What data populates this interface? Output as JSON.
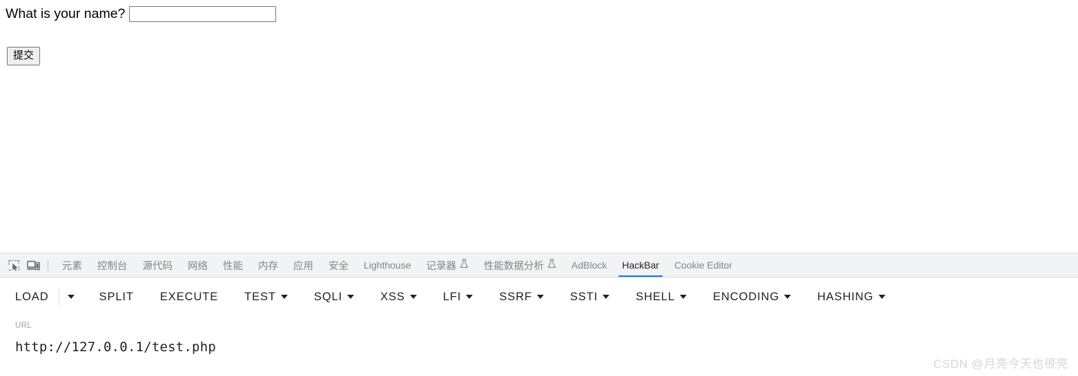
{
  "page": {
    "question_label": "What is your name?",
    "name_input_value": "",
    "name_input_placeholder": "",
    "submit_label": "提交"
  },
  "devtools": {
    "icons": [
      {
        "name": "inspect-element-icon",
        "label": "检查元素"
      },
      {
        "name": "device-toolbar-icon",
        "label": "切换设备工具栏"
      }
    ],
    "tabs": [
      {
        "label": "元素",
        "active": false,
        "experimental": false,
        "lang": "cn"
      },
      {
        "label": "控制台",
        "active": false,
        "experimental": false,
        "lang": "cn"
      },
      {
        "label": "源代码",
        "active": false,
        "experimental": false,
        "lang": "cn"
      },
      {
        "label": "网络",
        "active": false,
        "experimental": false,
        "lang": "cn"
      },
      {
        "label": "性能",
        "active": false,
        "experimental": false,
        "lang": "cn"
      },
      {
        "label": "内存",
        "active": false,
        "experimental": false,
        "lang": "cn"
      },
      {
        "label": "应用",
        "active": false,
        "experimental": false,
        "lang": "cn"
      },
      {
        "label": "安全",
        "active": false,
        "experimental": false,
        "lang": "cn"
      },
      {
        "label": "Lighthouse",
        "active": false,
        "experimental": false,
        "lang": "en"
      },
      {
        "label": "记录器",
        "active": false,
        "experimental": true,
        "lang": "cn"
      },
      {
        "label": "性能数据分析",
        "active": false,
        "experimental": true,
        "lang": "cn"
      },
      {
        "label": "AdBlock",
        "active": false,
        "experimental": false,
        "lang": "en"
      },
      {
        "label": "HackBar",
        "active": true,
        "experimental": false,
        "lang": "en"
      },
      {
        "label": "Cookie Editor",
        "active": false,
        "experimental": false,
        "lang": "en"
      }
    ],
    "active_tab": "HackBar",
    "accent_color": "#1a73e8",
    "tabbar_background": "#f1f3f4"
  },
  "hackbar": {
    "buttons": [
      {
        "label": "LOAD",
        "caret": false
      },
      {
        "label": "SPLIT",
        "caret": false
      },
      {
        "label": "EXECUTE",
        "caret": false
      },
      {
        "label": "TEST",
        "caret": true
      },
      {
        "label": "SQLI",
        "caret": true
      },
      {
        "label": "XSS",
        "caret": true
      },
      {
        "label": "LFI",
        "caret": true
      },
      {
        "label": "SSRF",
        "caret": true
      },
      {
        "label": "SSTI",
        "caret": true
      },
      {
        "label": "SHELL",
        "caret": true
      },
      {
        "label": "ENCODING",
        "caret": true
      },
      {
        "label": "HASHING",
        "caret": true
      }
    ],
    "load_dropdown_caret": "▼",
    "url_label": "URL",
    "url_value": "http://127.0.0.1/test.php"
  },
  "watermark": {
    "text": "CSDN @月亮今天也很亮"
  }
}
